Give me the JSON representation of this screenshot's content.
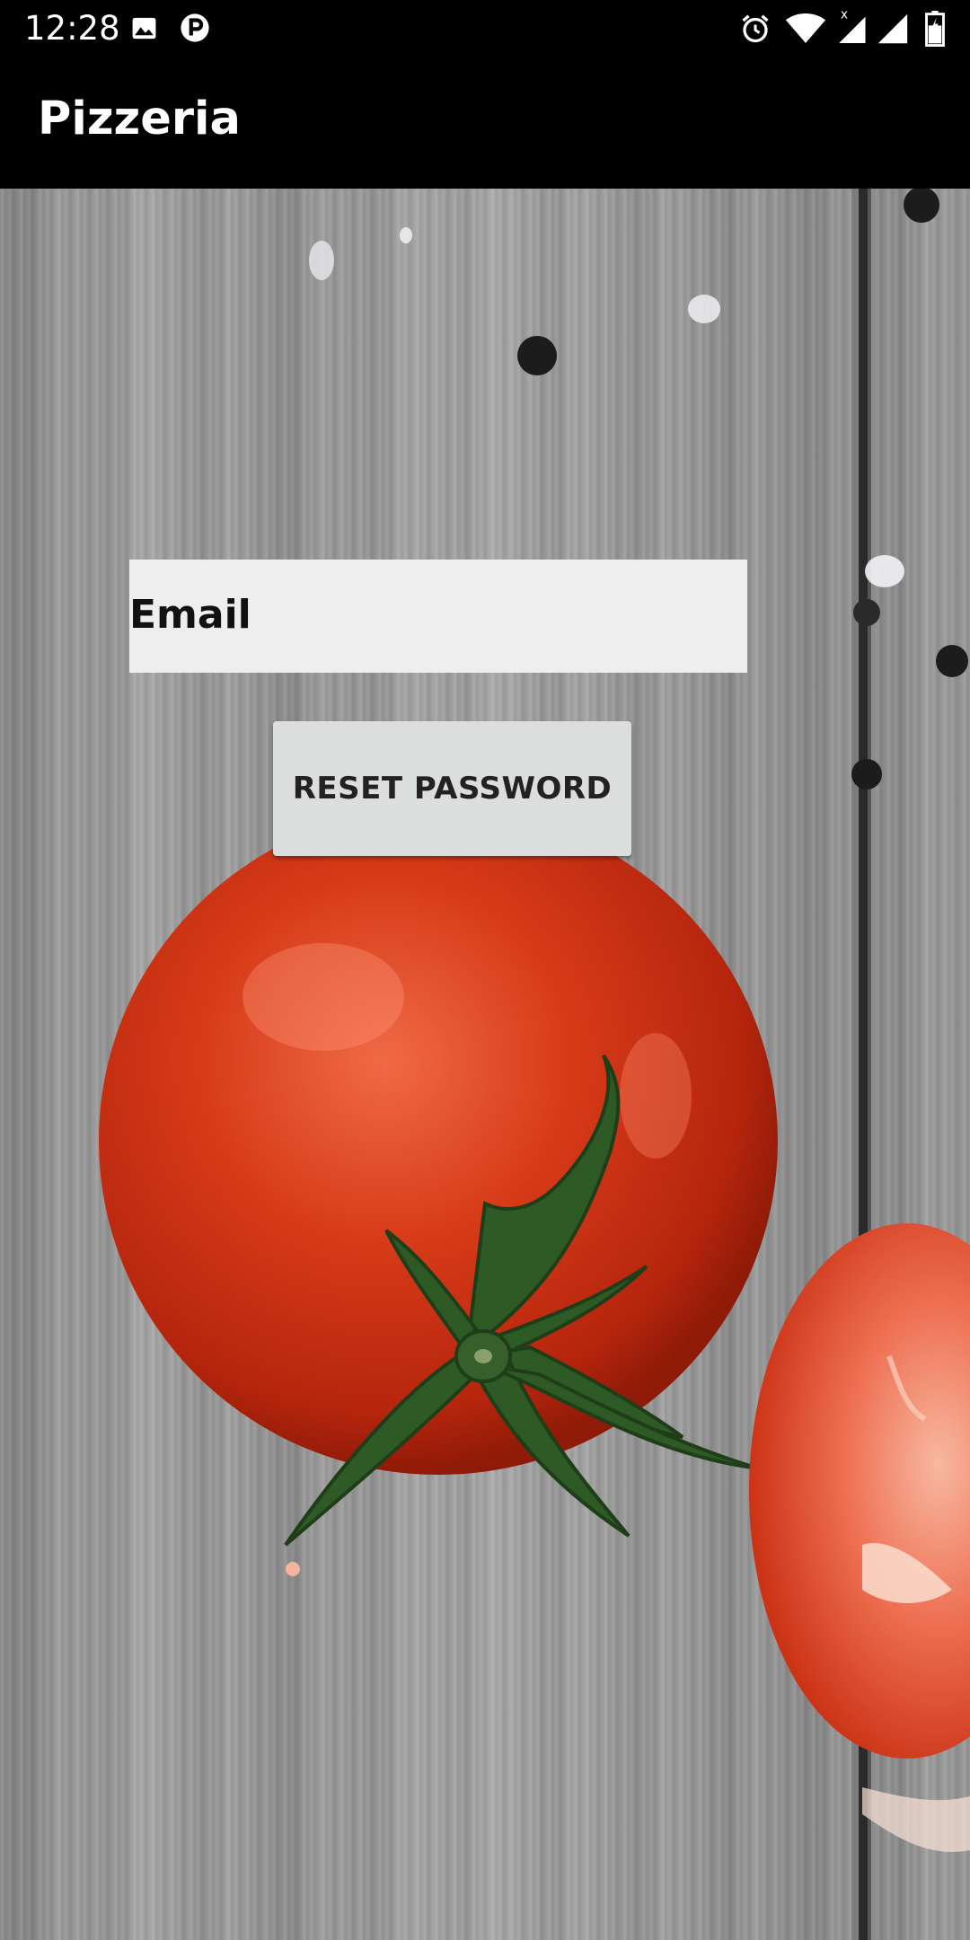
{
  "status_bar": {
    "time": "12:28",
    "icons": [
      "image-notification-icon",
      "parking-app-icon",
      "alarm-icon",
      "wifi-icon",
      "signal-x-icon",
      "signal-icon",
      "battery-icon"
    ]
  },
  "app_bar": {
    "title": "Pizzeria"
  },
  "form": {
    "email_placeholder": "Email",
    "reset_button_label": "RESET PASSWORD"
  },
  "colors": {
    "app_bar": "#000000",
    "input_background": "#eeeeee",
    "button_background": "#dcdddd",
    "tomato": "#d63a18"
  }
}
